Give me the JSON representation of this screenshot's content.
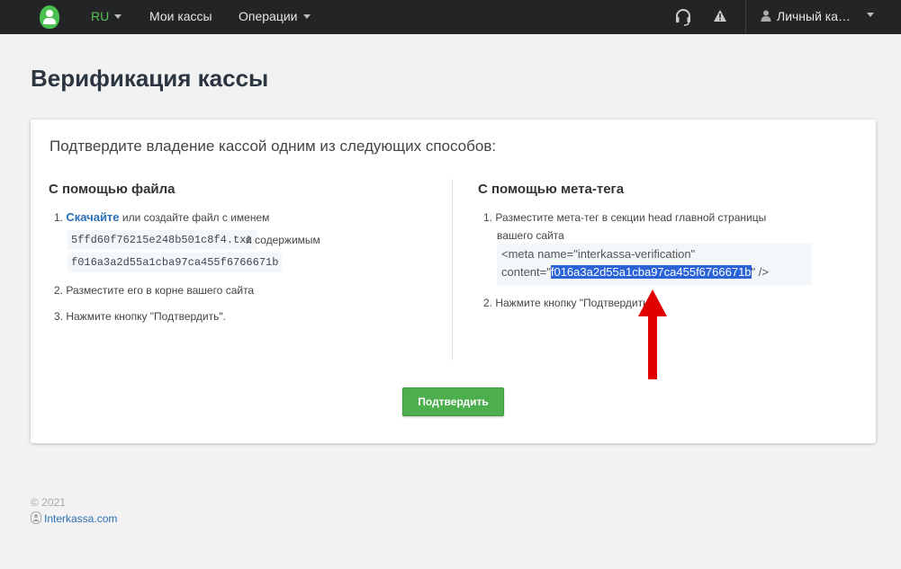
{
  "navbar": {
    "lang": "RU",
    "my_cashboxes": "Мои кассы",
    "operations": "Операции",
    "account": "Личный ка…"
  },
  "page": {
    "title": "Верификация кассы",
    "intro": "Подтвердите владение кассой одним из следующих способов:"
  },
  "file_method": {
    "title": "С помощью файла",
    "step1_num": "1.",
    "step1_link": "Скачайте",
    "step1_text": " или создайте файл с именем",
    "file_name": "5ffd60f76215e248b501c8f4.txt",
    "contents_text": "и содержимым",
    "file_content": "f016a3a2d55a1cba97ca455f6766671b",
    "step2": "2. Разместите его в корне вашего сайта",
    "step3": "3. Нажмите кнопку \"Подтвердить\"."
  },
  "meta_method": {
    "title": "С помощью мета-тега",
    "step1_line1": "1. Разместите мета-тег в секции head главной страницы",
    "step1_line2": "вашего сайта",
    "meta_line1": "<meta name=\"interkassa-verification\"",
    "meta_prefix": "content=\"",
    "meta_value": "f016a3a2d55a1cba97ca455f6766671b",
    "meta_suffix": "\" />",
    "step2": "2. Нажмите кнопку \"Подтвердить\"."
  },
  "confirm_button": "Подтвердить",
  "footer": {
    "year": "© 2021",
    "link": "Interkassa.com"
  },
  "colors": {
    "navbar": "#222426",
    "accent_green": "#4cae4c",
    "link_blue": "#2b6fb6",
    "highlight": "#2a63d7",
    "arrow_red": "#e00000"
  }
}
